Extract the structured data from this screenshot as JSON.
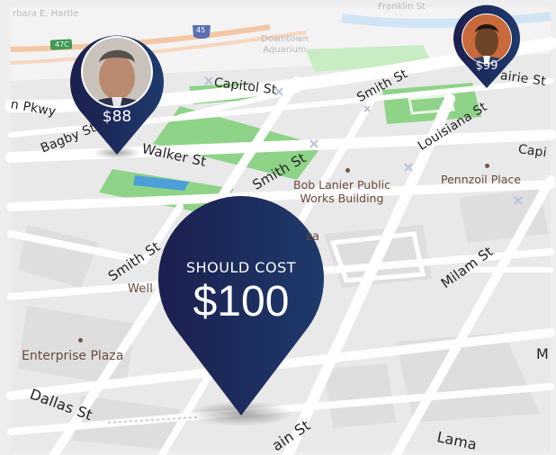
{
  "map": {
    "faint_labels": {
      "barbara": "rbara E. Hartle",
      "franklin": "Franklin St",
      "downtown_aquarium": "Downtown\nAquarium",
      "shield_47c": "47C",
      "shield_45": "45"
    },
    "streets": {
      "capitol_top": "Capitol St",
      "smith_top": "Smith St",
      "louisiana": "Louisiana St",
      "prairie": "airie St",
      "capitol_right": "Capi",
      "pkwy": "n Pkwy",
      "bagby": "Bagby St",
      "walker": "Walker St",
      "smith_mid": "Smith St",
      "smith_left": "Smith St",
      "milam": "Milam St",
      "dallas": "Dallas St",
      "main": "ain St",
      "lamar": "Lama",
      "m_right": "M",
      "wells_partial": "Well",
      "plaza_partial": "za"
    },
    "pois": {
      "bob_lanier": "Bob Lanier Public\nWorks Building",
      "pennzoil": "Pennzoil Place",
      "enterprise": "Enterprise Plaza"
    }
  },
  "pins": {
    "left": {
      "price": "$88",
      "avatar": "person-avatar"
    },
    "right": {
      "price": "$99",
      "avatar": "person-avatar"
    },
    "main": {
      "title": "SHOULD COST",
      "price": "$100"
    }
  },
  "colors": {
    "pin_dark": "#1c2150",
    "pin_mid": "#1d3366",
    "park": "#8ed387",
    "water": "#4c9fd9",
    "road": "#ffffff",
    "block": "#e8e8e8"
  }
}
